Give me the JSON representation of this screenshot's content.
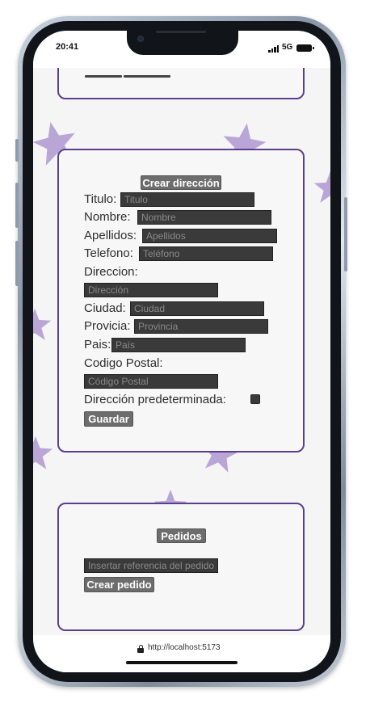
{
  "status_bar": {
    "time": "20:41",
    "network": "5G"
  },
  "address_form": {
    "header_button": "Crear dirección",
    "fields": [
      {
        "label": "Titulo:",
        "placeholder": "Titulo"
      },
      {
        "label": "Nombre:",
        "placeholder": "Nombre"
      },
      {
        "label": "Apellidos:",
        "placeholder": "Apellidos"
      },
      {
        "label": "Telefono:",
        "placeholder": "Teléfono"
      },
      {
        "label": "Direccion:",
        "placeholder": "Dirección"
      },
      {
        "label": "Ciudad:",
        "placeholder": "Ciudad"
      },
      {
        "label": "Provicia:",
        "placeholder": "Provincia"
      },
      {
        "label": "Pais:",
        "placeholder": "País"
      },
      {
        "label": "Codigo Postal:",
        "placeholder": "Código Postal"
      }
    ],
    "default_label": "Dirección predeterminada:",
    "save_button": "Guardar"
  },
  "orders": {
    "header_button": "Pedidos",
    "reference_placeholder": "Insertar referencia del pedido",
    "create_button": "Crear pedido"
  },
  "browser": {
    "url": "http://localhost:5173"
  },
  "colors": {
    "card_border": "#5b3f8e",
    "star": "#b9a6d6",
    "input_bg": "#3a3a3a",
    "button_bg": "#6d6d6d"
  }
}
